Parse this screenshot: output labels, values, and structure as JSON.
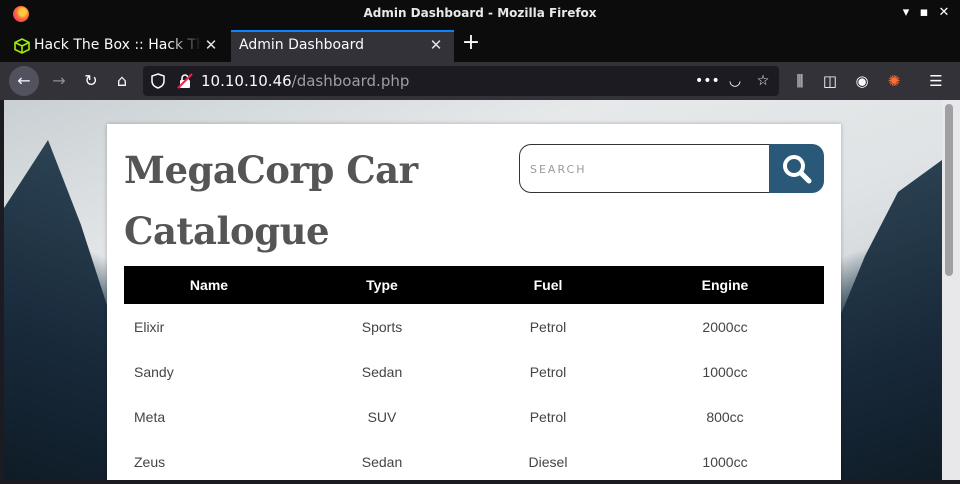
{
  "window": {
    "title": "Admin Dashboard - Mozilla Firefox"
  },
  "tabs": [
    {
      "label": "Hack The Box :: Hack The Box",
      "icon": "hackthebox-cube-icon",
      "active": false
    },
    {
      "label": "Admin Dashboard",
      "icon": "",
      "active": true
    }
  ],
  "navbar": {
    "url_host": "10.10.10.46",
    "url_path": "/dashboard.php"
  },
  "page": {
    "brand": "MegaCorp Car Catalogue",
    "search": {
      "placeholder": "SEARCH"
    },
    "accent": "#2a5878",
    "table": {
      "headers": [
        "Name",
        "Type",
        "Fuel",
        "Engine"
      ],
      "rows": [
        [
          "Elixir",
          "Sports",
          "Petrol",
          "2000cc"
        ],
        [
          "Sandy",
          "Sedan",
          "Petrol",
          "1000cc"
        ],
        [
          "Meta",
          "SUV",
          "Petrol",
          "800cc"
        ],
        [
          "Zeus",
          "Sedan",
          "Diesel",
          "1000cc"
        ]
      ]
    }
  }
}
